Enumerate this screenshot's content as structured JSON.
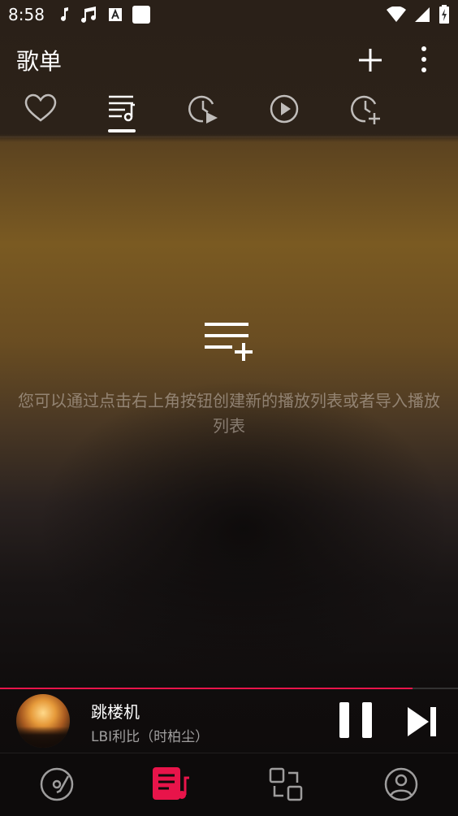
{
  "status_bar": {
    "time": "8:58",
    "left_icons": [
      "music-note-icon",
      "music-notes-icon",
      "a-letter-icon",
      "white-square-icon"
    ],
    "right_icons": [
      "wifi-icon",
      "signal-icon",
      "battery-icon"
    ]
  },
  "app_bar": {
    "title": "歌单",
    "add_icon": "plus-icon",
    "more_icon": "more-vertical-icon"
  },
  "tabs": [
    {
      "icon": "heart-icon",
      "selected": false
    },
    {
      "icon": "playlist-music-icon",
      "selected": true
    },
    {
      "icon": "history-play-icon",
      "selected": false
    },
    {
      "icon": "play-circle-icon",
      "selected": false
    },
    {
      "icon": "history-add-icon",
      "selected": false
    }
  ],
  "empty_state": {
    "icon": "playlist-add-icon",
    "message": "您可以通过点击右上角按钮创建新的播放列表或者导入播放列表"
  },
  "mini_player": {
    "title": "跳楼机",
    "artist": "LBI利比（时柏尘）",
    "progress": 0.9,
    "accent": "#e8144a"
  },
  "bottom_nav": [
    {
      "icon": "disc-icon",
      "selected": false
    },
    {
      "icon": "playlist-music-icon",
      "selected": true
    },
    {
      "icon": "swap-screens-icon",
      "selected": false
    },
    {
      "icon": "account-icon",
      "selected": false
    }
  ],
  "colors": {
    "accent": "#e8144a",
    "text_muted": "#b8aca0"
  }
}
